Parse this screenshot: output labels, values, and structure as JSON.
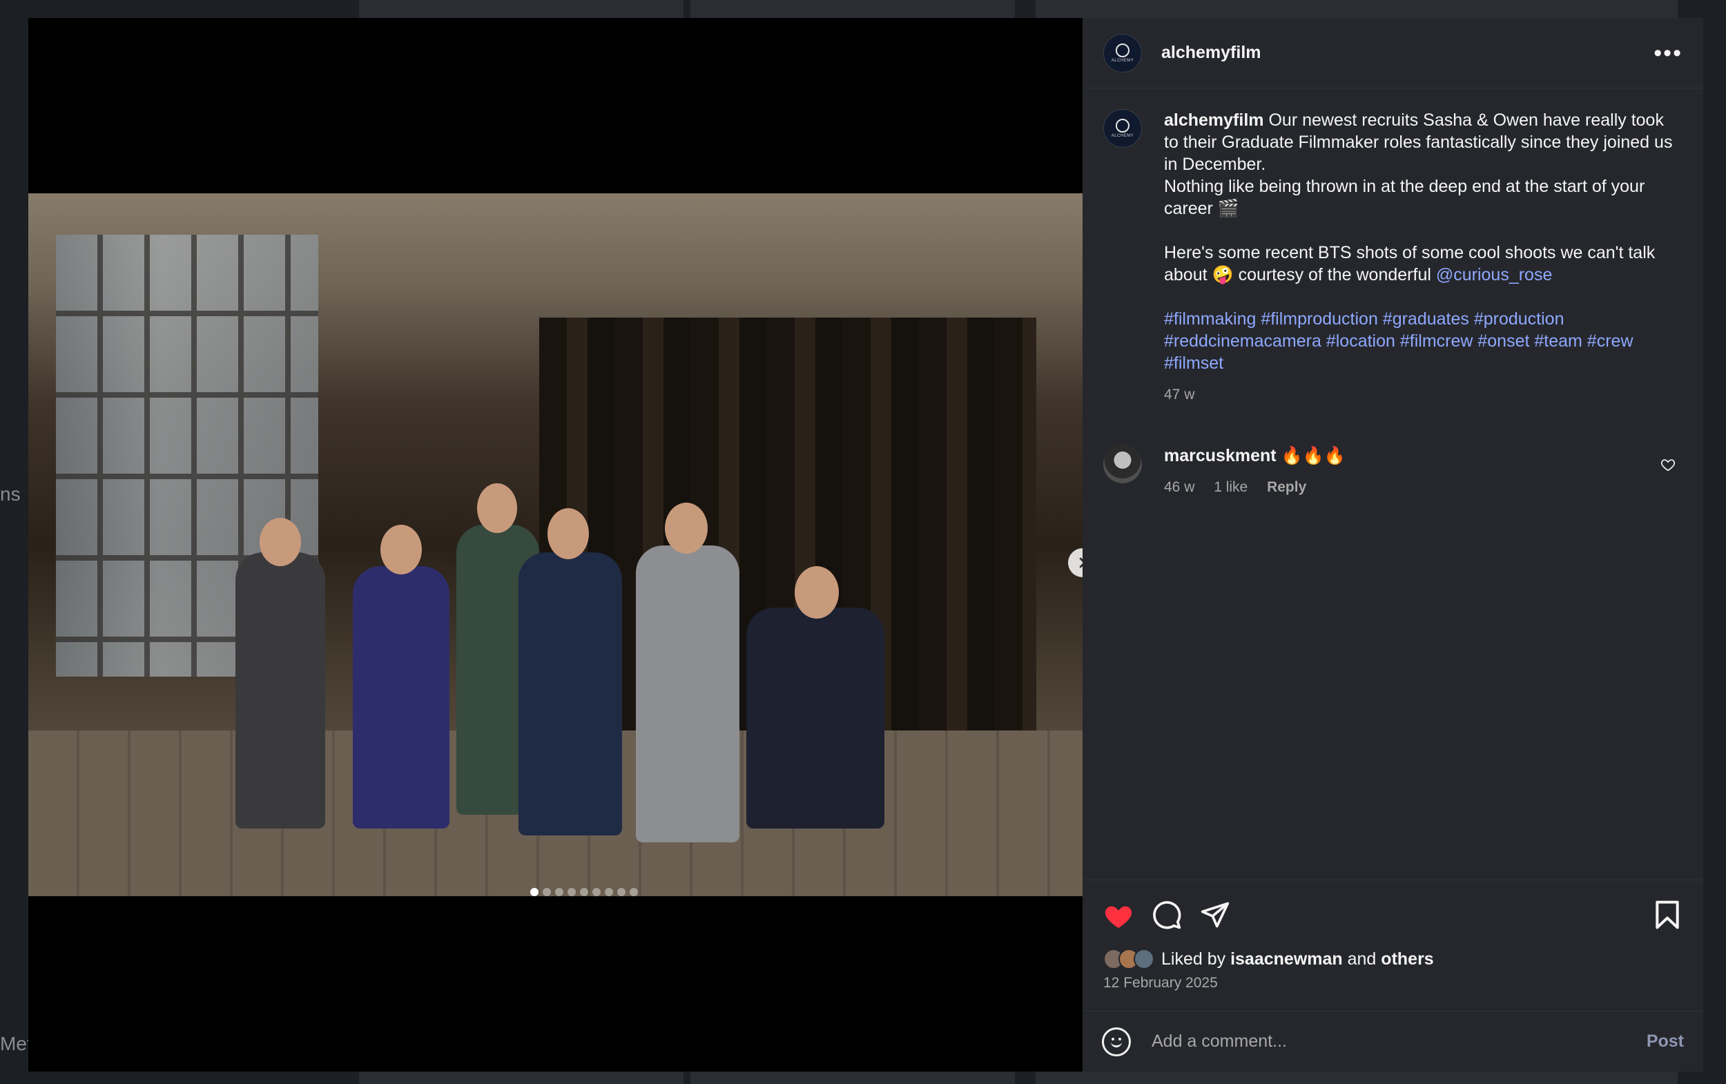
{
  "background": {
    "left_text_1": "ns",
    "left_text_2": "Met"
  },
  "post": {
    "author": "alchemyfilm",
    "avatar_label": "ALCHEMY",
    "more_icon": "more-horizontal-icon",
    "carousel": {
      "slide_count": 9,
      "active_index": 0
    },
    "caption": {
      "username": "alchemyfilm",
      "line1": "Our newest recruits Sasha & Owen have really took to their Graduate Filmmaker roles fantastically since they joined us in December.",
      "line2": "Nothing like being thrown in at the deep end at the start of your career 🎬",
      "line3_before": "Here's some recent BTS shots of some cool shoots we can't talk about 🤪 courtesy of the wonderful ",
      "mention": "@curious_rose",
      "hashtags": "#filmmaking #filmproduction #graduates #production #reddcinemacamera #location #filmcrew #onset #team #crew #filmset",
      "time": "47 w"
    },
    "comments": [
      {
        "username": "marcuskment",
        "text": "🔥🔥🔥",
        "time": "46 w",
        "likes": "1 like",
        "reply_label": "Reply"
      }
    ],
    "liked_by_prefix": "Liked by",
    "liked_by_user": "isaacnewman",
    "liked_by_and": "and",
    "liked_by_others": "others",
    "date": "12 February 2025",
    "add_comment_placeholder": "Add a comment...",
    "post_label": "Post"
  },
  "colors": {
    "like_red": "#ff3040",
    "link_blue": "#8fa8ff"
  }
}
